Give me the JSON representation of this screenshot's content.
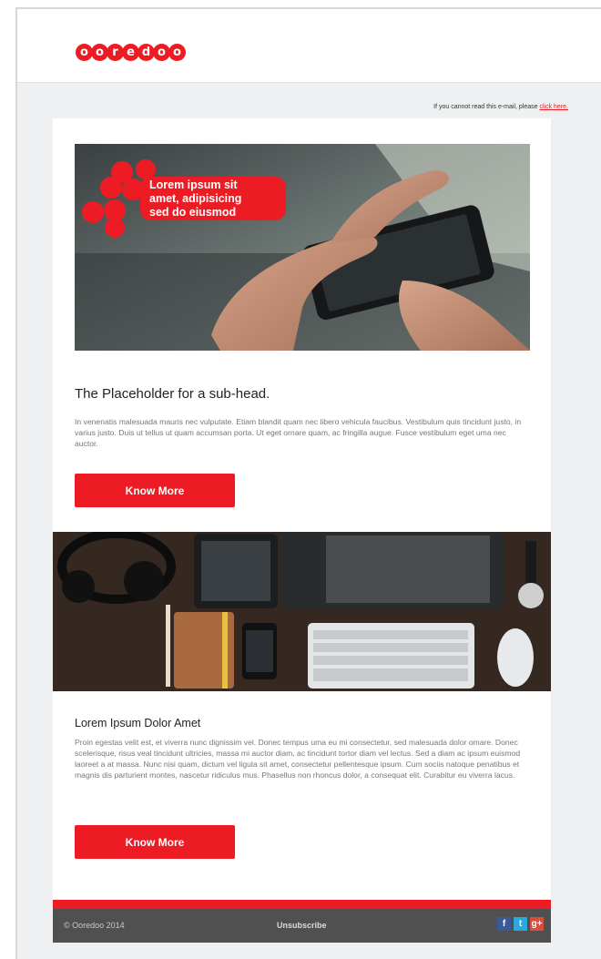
{
  "brand": {
    "logo_text": "ooredoo",
    "accent_color": "#ed1c24"
  },
  "notice": {
    "prefix": "If you cannot read this e-mail, please ",
    "link": "click here."
  },
  "hero": {
    "overlay_line1": "Lorem ipsum  sit",
    "overlay_line2": "amet, adipisicing",
    "overlay_line3": "sed do eiusmod"
  },
  "section1": {
    "subhead": "The Placeholder for a sub-head.",
    "body": "In venenatis malesuada mauris nec vulputate. Etiam blandit quam nec libero vehicula faucibus. Vestibulum quis tincidunt justo, in varius justo. Duis ut tellus ut quam accumsan porta. Ut eget ornare quam, ac fringilla augue. Fusce vestibulum eget uma nec auctor.",
    "button": "Know More"
  },
  "section2": {
    "heading": "Lorem Ipsum Dolor Amet",
    "body": "Proin egestas velit est, et viverra nunc dignissim vel. Donec tempus uma eu mi consectetur, sed malesuada dolor omare. Donec scelerisque, risus veal tincidunt ultricies, massa mi auctor diam, ac tincidunt tortor diam vel lectus. Sed a diam ac ipsum euismod laoreet a at massa. Nunc nisi quam, dictum vel ligula sit amet, consectetur pellentesque ipsum. Cum sociis natoque penatibus et magnis dis parturient montes, nascetur ridiculus mus. Phasellus non rhoncus dolor, a consequat elit. Curabitur eu viverra lacus.",
    "button": "Know More"
  },
  "footer": {
    "copyright": "© Ooredoo 2014",
    "unsubscribe": "Unsubscribe",
    "social": [
      {
        "name": "facebook-icon",
        "glyph": "f"
      },
      {
        "name": "twitter-icon",
        "glyph": "t"
      },
      {
        "name": "google-plus-icon",
        "glyph": "g+"
      }
    ]
  }
}
